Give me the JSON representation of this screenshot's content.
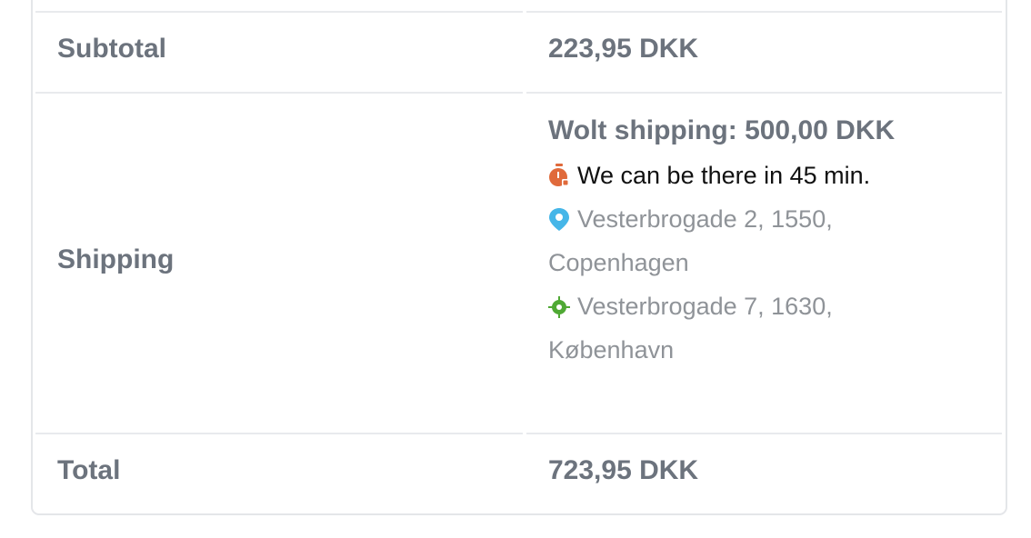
{
  "colors": {
    "timer_icon": "#e06a3b",
    "pickup_pin_icon": "#46b6e8",
    "dropoff_target_icon": "#4fa934"
  },
  "rows": {
    "subtotal": {
      "label": "Subtotal",
      "value": "223,95 DKK"
    },
    "shipping": {
      "label": "Shipping",
      "method": "Wolt shipping: 500,00 DKK",
      "eta": "We can be there in 45 min.",
      "pickup_line1": "Vesterbrogade 2, 1550,",
      "pickup_line2": "Copenhagen",
      "dropoff_line1": "Vesterbrogade 7, 1630,",
      "dropoff_line2": "København"
    },
    "total": {
      "label": "Total",
      "value": "723,95 DKK"
    }
  },
  "icons": {
    "eta": "timer-icon",
    "pickup": "map-pin-icon",
    "dropoff": "target-location-icon"
  }
}
